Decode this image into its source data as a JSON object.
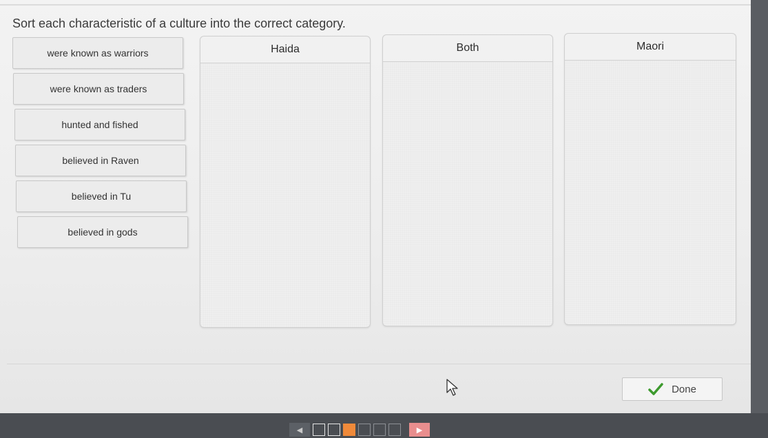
{
  "prompt": "Sort each characteristic of a culture into the correct category.",
  "tiles": [
    {
      "label": "were known as warriors"
    },
    {
      "label": "were known as traders"
    },
    {
      "label": "hunted and fished"
    },
    {
      "label": "believed in Raven"
    },
    {
      "label": "believed in Tu"
    },
    {
      "label": "believed in gods"
    }
  ],
  "bins": [
    {
      "label": "Haida"
    },
    {
      "label": "Both"
    },
    {
      "label": "Maori"
    }
  ],
  "done_label": "Done",
  "icons": {
    "done": "check-icon",
    "cursor": "mouse-pointer-icon",
    "prev": "left-arrow-icon",
    "next": "right-arrow-icon"
  },
  "colors": {
    "current_page": "#f08a3a",
    "next_arrow": "#e98e8e",
    "check": "#3d9a2e"
  },
  "pager": {
    "prev_glyph": "◀",
    "next_glyph": "▶"
  }
}
